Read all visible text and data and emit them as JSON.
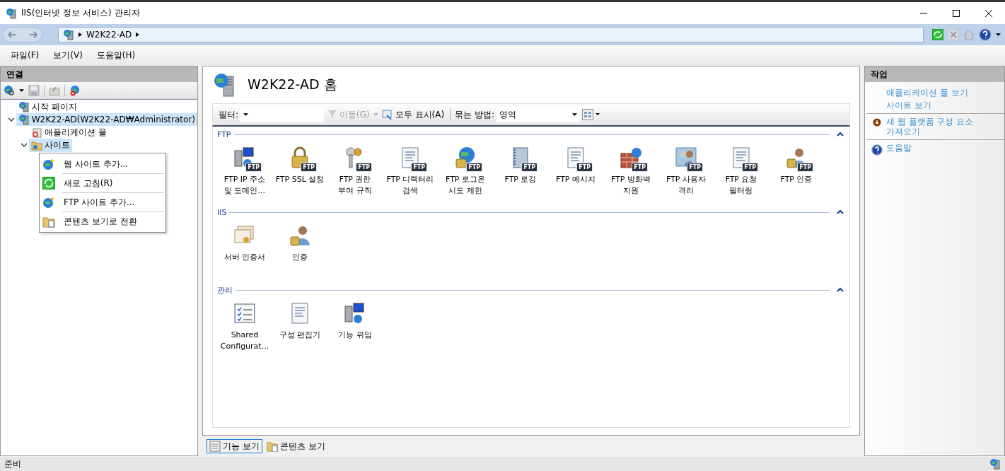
{
  "window": {
    "title": "IIS(인터넷 정보 서비스) 관리자"
  },
  "address": {
    "crumbs": [
      "W2K22-AD"
    ]
  },
  "menu": [
    {
      "label": "파일(F)"
    },
    {
      "label": "보기(V)"
    },
    {
      "label": "도움말(H)"
    }
  ],
  "connections": {
    "title": "연결",
    "tree": [
      {
        "label": "시작 페이지",
        "selected": false
      },
      {
        "label": "W2K22-AD(W2K22-AD₩Administrator)",
        "selected": true,
        "expanded": true,
        "children": [
          {
            "label": "애플리케이션 풀",
            "selected": false
          },
          {
            "label": "사이트",
            "selected": true,
            "expanded": true
          }
        ]
      }
    ]
  },
  "context_menu": [
    {
      "label": "웹 사이트 추가..."
    },
    {
      "label": "새로 고침(R)"
    },
    {
      "label": "FTP 사이트 추가..."
    },
    {
      "label": "콘텐츠 보기로 전환"
    }
  ],
  "page": {
    "title": "W2K22-AD 홈",
    "filter": {
      "label": "필터:",
      "go": "이동(G)",
      "go_disabled": true,
      "show_all": "모두 표시(A)",
      "group_label": "묶는 방법:",
      "group_value": "영역"
    },
    "groups": [
      {
        "title": "FTP",
        "expanded": true,
        "features": [
          {
            "label": "FTP IP 주소\n및 도메인...",
            "badge": "FTP"
          },
          {
            "label": "FTP SSL 설정",
            "badge": "FTP"
          },
          {
            "label": "FTP 권한\n부여 규칙",
            "badge": "FTP"
          },
          {
            "label": "FTP 디렉터리\n검색",
            "badge": "FTP"
          },
          {
            "label": "FTP 로그온\n시도 제한",
            "badge": "FTP"
          },
          {
            "label": "FTP 로깅",
            "badge": "FTP"
          },
          {
            "label": "FTP 메시지",
            "badge": "FTP"
          },
          {
            "label": "FTP 방화벽\n지원",
            "badge": "FTP"
          },
          {
            "label": "FTP 사용자\n격리",
            "badge": "FTP"
          },
          {
            "label": "FTP 요청\n필터링",
            "badge": "FTP"
          },
          {
            "label": "FTP 인증",
            "badge": "FTP"
          }
        ]
      },
      {
        "title": "IIS",
        "expanded": true,
        "features": [
          {
            "label": "서버 인증서"
          },
          {
            "label": "인증"
          }
        ]
      },
      {
        "title": "관리",
        "expanded": true,
        "features": [
          {
            "label": "Shared\nConfigurat..."
          },
          {
            "label": "구성 편집기"
          },
          {
            "label": "기능 위임"
          }
        ]
      }
    ]
  },
  "view_tabs": [
    {
      "label": "기능 보기",
      "selected": true
    },
    {
      "label": "콘텐츠 보기",
      "selected": false
    }
  ],
  "actions": {
    "title": "작업",
    "groups": [
      [
        {
          "label": "애플리케이션 풀 보기"
        },
        {
          "label": "사이트 보기"
        }
      ],
      [
        {
          "label": "새 웹 플랫폼 구성 요소 가져오기"
        }
      ],
      [
        {
          "label": "도움말"
        }
      ]
    ]
  },
  "status_bar": {
    "text": "준비"
  }
}
